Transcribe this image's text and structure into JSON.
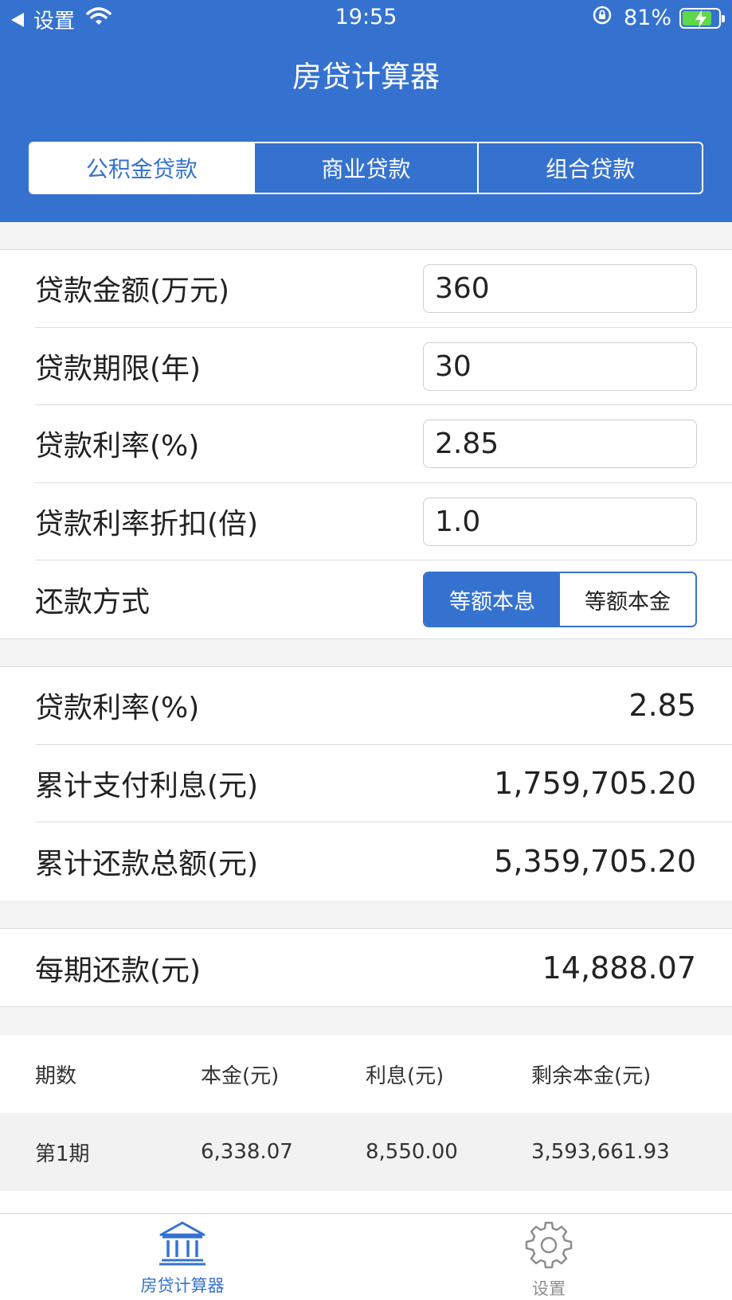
{
  "status_bar": {
    "back_label": "设置",
    "time": "19:55",
    "battery": "81%",
    "battery_level": 0.81,
    "colors": {
      "battery_fill": "#5fd84a"
    }
  },
  "header": {
    "title": "房贷计算器",
    "tabs": [
      {
        "label": "公积金贷款",
        "active": true
      },
      {
        "label": "商业贷款",
        "active": false
      },
      {
        "label": "组合贷款",
        "active": false
      }
    ]
  },
  "form": {
    "amount": {
      "label": "贷款金额(万元)",
      "value": "360"
    },
    "term": {
      "label": "贷款期限(年)",
      "value": "30"
    },
    "rate": {
      "label": "贷款利率(%)",
      "value": "2.85"
    },
    "discount": {
      "label": "贷款利率折扣(倍)",
      "value": "1.0"
    },
    "method": {
      "label": "还款方式",
      "options": [
        "等额本息",
        "等额本金"
      ],
      "selected": "等额本息"
    }
  },
  "summary": {
    "rate": {
      "label": "贷款利率(%)",
      "value": "2.85"
    },
    "interest": {
      "label": "累计支付利息(元)",
      "value": "1,759,705.20"
    },
    "total": {
      "label": "累计还款总额(元)",
      "value": "5,359,705.20"
    }
  },
  "monthly": {
    "label": "每期还款(元)",
    "value": "14,888.07"
  },
  "schedule": {
    "headers": [
      "期数",
      "本金(元)",
      "利息(元)",
      "剩余本金(元)"
    ],
    "rows": [
      [
        "第1期",
        "6,338.07",
        "8,550.00",
        "3,593,661.93"
      ]
    ]
  },
  "tabbar": {
    "items": [
      {
        "label": "房贷计算器",
        "icon": "bank-icon",
        "active": true
      },
      {
        "label": "设置",
        "icon": "gear-icon",
        "active": false
      }
    ]
  },
  "colors": {
    "accent": "#3572d0",
    "background_gray": "#f3f3f3"
  }
}
